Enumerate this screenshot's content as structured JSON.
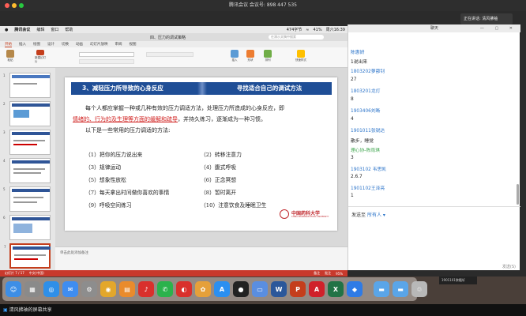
{
  "meeting": {
    "title": "腾讯会议 会议号: 898 447 535",
    "speaker_toast": "正在讲话: 清风拂袖"
  },
  "menubar": {
    "items": [
      "腾讯会议",
      "编辑",
      "窗口",
      "帮助"
    ],
    "status": [
      "474字节",
      "41%",
      "周六16:39"
    ]
  },
  "ppt": {
    "window_title": "四、压力的调试策略",
    "search_placeholder": "在演示文稿中搜索",
    "tabs": [
      "开始",
      "插入",
      "绘图",
      "设计",
      "切换",
      "动画",
      "幻灯片放映",
      "审阅",
      "视图"
    ],
    "ribbon_buttons": [
      "粘贴",
      "新建幻灯片",
      "插入",
      "形状",
      "排列",
      "快速样式"
    ],
    "slide": {
      "header_left": "3、减轻压力所导致的心身反应",
      "header_right": "寻找适合自己的调试方法",
      "para1_line1": "每个人都应掌握一种或几种有效的压力调适方法，处理压力所造成的心身反应，即",
      "para1_line2_red": "情绪的、行为的及生理等方面的缓解和疏导",
      "para1_line2_rest": "，并持久练习，逐渐成为一种习惯。",
      "para2": "以下是一些常用的压力调适的方法:",
      "methods": [
        "（1）把你的压力说出来",
        "（2）转移注意力",
        "（3）规律运动",
        "（4）腹式呼吸",
        "（5）想象性放松",
        "（6）正念冥想",
        "（7）每天拿出时间做你喜欢的事情",
        "（8）暂时离开",
        "（9）呼吸空间练习",
        "（10）注意饮食及睡眠卫生"
      ],
      "university": "中国药科大学",
      "university_en": "CHINA PHARMACEUTICAL UNIVERSITY"
    },
    "notes_placeholder": "单击此处添加备注",
    "status": {
      "slide_position": "幻灯片 7 / 17",
      "language": "中文(中国)",
      "notes": "备注",
      "comments": "批注",
      "zoom": "95%"
    },
    "thumbnail_numbers": [
      "1",
      "2",
      "3",
      "4",
      "5",
      "6",
      "7"
    ]
  },
  "chat": {
    "title": "聊天",
    "messages": [
      {
        "sender": "陈惠妍",
        "body": "1说出来"
      },
      {
        "sender": "1803202萝蔀钊",
        "body": "27"
      },
      {
        "sender": "1803201龙灯",
        "body": "8"
      },
      {
        "sender": "1903406刘晰",
        "body": "4"
      },
      {
        "sender": "1901011张锐达",
        "body": "散步，睡觉"
      },
      {
        "sender": "理心协-陈雨琪",
        "body": "3"
      },
      {
        "sender": "1903102 韦思凯",
        "body": "2.6.7"
      },
      {
        "sender": "1901102王泽亮",
        "body": "1"
      }
    ],
    "send_to_label": "发送至",
    "send_to_target": "所有人",
    "send_button": "发送(S)"
  },
  "mini_video_label": "1901101黎籍轩",
  "share_bar": "清风拂袖的屏幕共享",
  "dock_icons": [
    {
      "name": "finder-icon",
      "color": "#3d8ee6",
      "glyph": "☺"
    },
    {
      "name": "launchpad-icon",
      "color": "#8a8a8a",
      "glyph": "▦"
    },
    {
      "name": "safari-icon",
      "color": "#2f8fe8",
      "glyph": "◎"
    },
    {
      "name": "mail-icon",
      "color": "#3f8df0",
      "glyph": "✉"
    },
    {
      "name": "system-preferences-icon",
      "color": "#8d8d8d",
      "glyph": "⚙"
    },
    {
      "name": "chrome-icon",
      "color": "#e3a72b",
      "glyph": "◉"
    },
    {
      "name": "books-icon",
      "color": "#e98b2c",
      "glyph": "▤"
    },
    {
      "name": "netease-music-icon",
      "color": "#d9302c",
      "glyph": "♪"
    },
    {
      "name": "wechat-icon",
      "color": "#2bb24c",
      "glyph": "✆"
    },
    {
      "name": "netease-icon",
      "color": "#d9302c",
      "glyph": "◐"
    },
    {
      "name": "photo-icon",
      "color": "#e5a03a",
      "glyph": "✿"
    },
    {
      "name": "app-store-icon",
      "color": "#2a8ff0",
      "glyph": "A"
    },
    {
      "name": "qq-icon",
      "color": "#222222",
      "glyph": "●"
    },
    {
      "name": "finder-window-icon",
      "color": "#5a8ee0",
      "glyph": "▭"
    },
    {
      "name": "word-icon",
      "color": "#2b579a",
      "glyph": "W"
    },
    {
      "name": "powerpoint-icon",
      "color": "#c43e1c",
      "glyph": "P"
    },
    {
      "name": "acrobat-icon",
      "color": "#d0202a",
      "glyph": "A"
    },
    {
      "name": "excel-icon",
      "color": "#217346",
      "glyph": "X"
    },
    {
      "name": "tencent-meeting-icon",
      "color": "#2f7be6",
      "glyph": "◆"
    },
    {
      "name": "folder-icon",
      "color": "#5aa5e8",
      "glyph": "▬"
    },
    {
      "name": "folder2-icon",
      "color": "#5aa5e8",
      "glyph": "▬"
    },
    {
      "name": "trash-icon",
      "color": "#b8b8b8",
      "glyph": "♲"
    }
  ]
}
